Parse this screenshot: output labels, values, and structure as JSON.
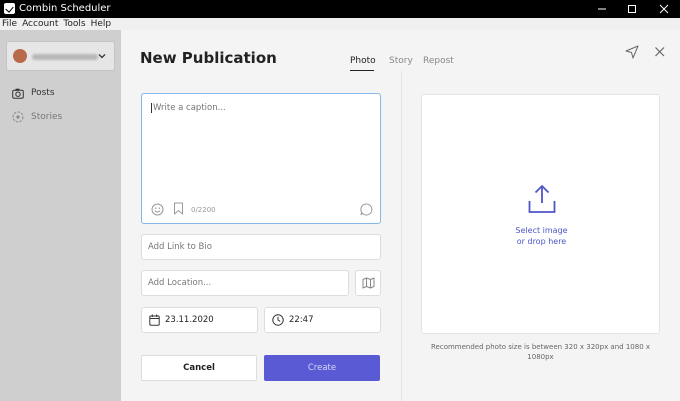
{
  "window": {
    "title": "Combin Scheduler"
  },
  "menu": [
    "File",
    "Account",
    "Tools",
    "Help"
  ],
  "sidebar": {
    "account": {
      "name_blurred": true
    },
    "items": [
      {
        "label": "Posts",
        "icon": "camera-icon"
      },
      {
        "label": "Stories",
        "icon": "stories-icon"
      }
    ]
  },
  "publication": {
    "title": "New Publication",
    "tabs": [
      {
        "label": "Photo",
        "active": true
      },
      {
        "label": "Story",
        "active": false
      },
      {
        "label": "Repost",
        "active": false
      }
    ],
    "caption": {
      "placeholder": "Write a caption...",
      "value": "",
      "counter": "0/2200"
    },
    "link_bio_placeholder": "Add Link to Bio",
    "location_placeholder": "Add Location...",
    "date": "23.11.2020",
    "time": "22:47",
    "cancel_label": "Cancel",
    "create_label": "Create",
    "upload": {
      "line1": "Select image",
      "line2": "or drop here",
      "hint": "Recommended photo size is between 320 x 320px and 1080 x 1080px"
    }
  },
  "colors": {
    "accent": "#5a5bd4",
    "focus_border": "#86b7e8",
    "upload_text": "#4e56c9"
  }
}
